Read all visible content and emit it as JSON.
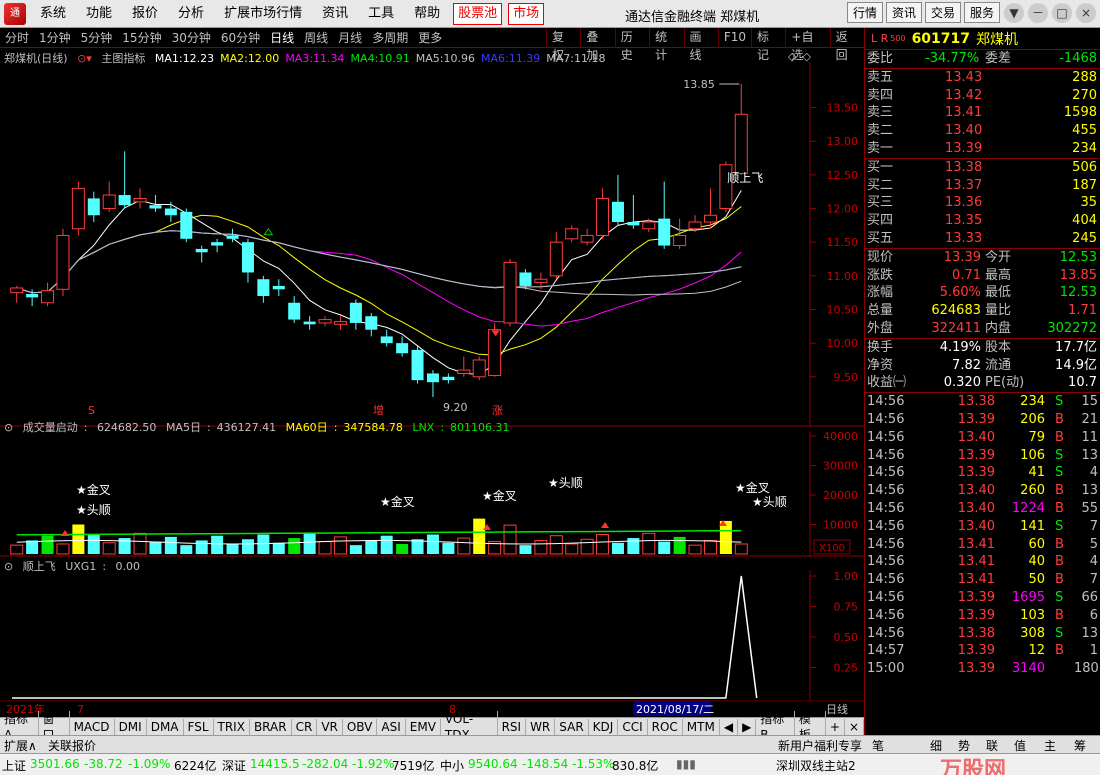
{
  "app": {
    "logo": "通",
    "menu": [
      "系统",
      "功能",
      "报价",
      "分析",
      "扩展市场行情",
      "资讯",
      "工具",
      "帮助"
    ],
    "menu_highlight": [
      "股票池",
      "市场"
    ],
    "title": "通达信金融终端  郑煤机",
    "right_buttons": [
      "行情",
      "资讯",
      "交易",
      "服务"
    ],
    "window_buttons": [
      "▼",
      "－",
      "□",
      "×"
    ]
  },
  "periods": {
    "items": [
      "分时",
      "1分钟",
      "5分钟",
      "15分钟",
      "30分钟",
      "60分钟",
      "日线",
      "周线",
      "月线",
      "多周期",
      "更多"
    ],
    "active": "日线",
    "tools": [
      "复权",
      "叠加",
      "历史",
      "统计",
      "画线",
      "F10",
      "标记",
      "+自选",
      "返回"
    ]
  },
  "main_chart": {
    "stock_label": "郑煤机(日线)",
    "indicator_label": "主图指标",
    "ma": [
      {
        "name": "MA1",
        "value": "12.23",
        "color": "#ffffff"
      },
      {
        "name": "MA2",
        "value": "12.00",
        "color": "#ffff00"
      },
      {
        "name": "MA3",
        "value": "11.34",
        "color": "#ff00ff"
      },
      {
        "name": "MA4",
        "value": "10.91",
        "color": "#00e600"
      },
      {
        "name": "MA5",
        "value": "10.96",
        "color": "#c0c0c0"
      },
      {
        "name": "MA6",
        "value": "11.39",
        "color": "#3c3cff"
      },
      {
        "name": "MA7",
        "value": "11.18",
        "color": "#c0c0c0"
      }
    ],
    "annotations": {
      "high": "13.85",
      "low": "9.20",
      "fly": "顺上飞",
      "s_mark": "S",
      "zeng": "增",
      "zhang": "涨"
    }
  },
  "volume_chart": {
    "title": "成交量启动",
    "value": "624682.50",
    "ma5_label": "MA5日",
    "ma5": "436127.41",
    "ma60_label": "MA60日",
    "ma60": "347584.78",
    "lnx_label": "LNX",
    "lnx": "801106.31",
    "unit": "X100",
    "labels": {
      "jincha": "★金叉",
      "toushun": "★头顺"
    }
  },
  "ind_chart": {
    "title": "顺上飞",
    "value_label": "UXG1",
    "value": "0.00"
  },
  "chart_data": [
    {
      "type": "candlestick",
      "title": "郑煤机(日线)",
      "ylim": [
        9.2,
        13.85
      ],
      "yticks": [
        "13.50",
        "13.00",
        "12.50",
        "12.00",
        "11.50",
        "11.00",
        "10.50",
        "10.00",
        "9.50"
      ],
      "candles": [
        [
          10.75,
          10.82,
          10.6,
          10.85
        ],
        [
          10.73,
          10.68,
          10.55,
          10.8
        ],
        [
          10.6,
          10.78,
          10.55,
          10.9
        ],
        [
          10.8,
          11.6,
          10.7,
          11.7
        ],
        [
          11.7,
          12.3,
          11.6,
          12.4
        ],
        [
          12.15,
          11.9,
          11.8,
          12.25
        ],
        [
          12.0,
          12.2,
          11.95,
          12.4
        ],
        [
          12.2,
          12.05,
          12.0,
          12.85
        ],
        [
          12.1,
          12.15,
          12.0,
          12.3
        ],
        [
          12.05,
          12.0,
          11.95,
          12.2
        ],
        [
          12.0,
          11.9,
          11.8,
          12.1
        ],
        [
          11.95,
          11.55,
          11.5,
          12.0
        ],
        [
          11.4,
          11.35,
          11.2,
          11.45
        ],
        [
          11.5,
          11.45,
          11.35,
          11.55
        ],
        [
          11.6,
          11.55,
          11.5,
          11.7
        ],
        [
          11.5,
          11.05,
          10.9,
          11.55
        ],
        [
          10.95,
          10.7,
          10.6,
          11.0
        ],
        [
          10.85,
          10.8,
          10.7,
          10.95
        ],
        [
          10.6,
          10.35,
          10.3,
          10.7
        ],
        [
          10.32,
          10.28,
          10.2,
          10.4
        ],
        [
          10.3,
          10.35,
          10.25,
          10.4
        ],
        [
          10.28,
          10.32,
          10.2,
          10.4
        ],
        [
          10.6,
          10.3,
          10.2,
          10.65
        ],
        [
          10.4,
          10.2,
          10.1,
          10.45
        ],
        [
          10.1,
          10.0,
          9.95,
          10.2
        ],
        [
          10.0,
          9.85,
          9.8,
          10.1
        ],
        [
          9.9,
          9.45,
          9.4,
          9.95
        ],
        [
          9.55,
          9.42,
          9.2,
          9.6
        ],
        [
          9.5,
          9.45,
          9.4,
          9.55
        ],
        [
          9.55,
          9.6,
          9.5,
          9.8
        ],
        [
          9.5,
          9.75,
          9.45,
          9.8
        ],
        [
          9.52,
          10.2,
          9.5,
          10.3
        ],
        [
          10.3,
          11.2,
          10.25,
          11.25
        ],
        [
          11.05,
          10.85,
          10.8,
          11.1
        ],
        [
          10.9,
          10.95,
          10.8,
          11.05
        ],
        [
          11.0,
          11.5,
          10.95,
          11.65
        ],
        [
          11.55,
          11.7,
          11.5,
          11.75
        ],
        [
          11.5,
          11.6,
          11.45,
          11.7
        ],
        [
          11.6,
          12.15,
          11.55,
          12.3
        ],
        [
          12.1,
          11.8,
          11.75,
          12.5
        ],
        [
          11.8,
          11.75,
          11.7,
          12.2
        ],
        [
          11.7,
          11.8,
          11.65,
          11.85
        ],
        [
          11.85,
          11.45,
          11.4,
          12.4
        ],
        [
          11.45,
          11.6,
          11.4,
          11.85
        ],
        [
          11.7,
          11.8,
          11.65,
          11.9
        ],
        [
          11.8,
          11.9,
          11.7,
          12.3
        ],
        [
          12.0,
          12.65,
          11.95,
          12.7
        ],
        [
          12.52,
          13.4,
          12.5,
          13.85
        ]
      ],
      "ma_series": [
        {
          "name": "MA1",
          "color": "#ffffff"
        },
        {
          "name": "MA2",
          "color": "#ffff00"
        },
        {
          "name": "MA3",
          "color": "#ff00ff"
        },
        {
          "name": "MA4",
          "color": "#00e600"
        },
        {
          "name": "MA5",
          "color": "#c0c0c0"
        },
        {
          "name": "MA6",
          "color": "#3c3cff"
        },
        {
          "name": "MA7",
          "color": "#c0c0c0"
        }
      ]
    },
    {
      "type": "bar",
      "title": "成交量启动",
      "ylim": [
        0,
        40000
      ],
      "yticks": [
        "40000",
        "30000",
        "20000",
        "10000"
      ]
    },
    {
      "type": "line",
      "title": "顺上飞",
      "ylim": [
        0,
        1
      ],
      "yticks": [
        "1.00",
        "0.75",
        "0.50",
        "0.25"
      ]
    }
  ],
  "xaxis": {
    "year": "2021年",
    "m7": "7",
    "m8": "8",
    "date_box": "2021/08/17/二",
    "period": "日线"
  },
  "quote": {
    "lr": "L R",
    "sub": "500",
    "code": "601717",
    "name": "郑煤机",
    "weibi_label": "委比",
    "weibi": "-34.77%",
    "weicha_label": "委差",
    "weicha": "-1468",
    "asks": [
      {
        "label": "卖五",
        "price": "13.43",
        "vol": "288"
      },
      {
        "label": "卖四",
        "price": "13.42",
        "vol": "270"
      },
      {
        "label": "卖三",
        "price": "13.41",
        "vol": "1598"
      },
      {
        "label": "卖二",
        "price": "13.40",
        "vol": "455"
      },
      {
        "label": "卖一",
        "price": "13.39",
        "vol": "234"
      }
    ],
    "bids": [
      {
        "label": "买一",
        "price": "13.38",
        "vol": "506"
      },
      {
        "label": "买二",
        "price": "13.37",
        "vol": "187"
      },
      {
        "label": "买三",
        "price": "13.36",
        "vol": "35"
      },
      {
        "label": "买四",
        "price": "13.35",
        "vol": "404"
      },
      {
        "label": "买五",
        "price": "13.33",
        "vol": "245"
      }
    ],
    "stats": [
      {
        "l1": "现价",
        "v1": "13.39",
        "c1": "red",
        "l2": "今开",
        "v2": "12.53",
        "c2": "grn"
      },
      {
        "l1": "涨跌",
        "v1": "0.71",
        "c1": "red",
        "l2": "最高",
        "v2": "13.85",
        "c2": "red"
      },
      {
        "l1": "涨幅",
        "v1": "5.60%",
        "c1": "red",
        "l2": "最低",
        "v2": "12.53",
        "c2": "grn"
      },
      {
        "l1": "总量",
        "v1": "624683",
        "c1": "yel",
        "l2": "量比",
        "v2": "1.71",
        "c2": "red"
      },
      {
        "l1": "外盘",
        "v1": "322411",
        "c1": "red",
        "l2": "内盘",
        "v2": "302272",
        "c2": "grn"
      }
    ],
    "stats2": [
      {
        "l1": "换手",
        "v1": "4.19%",
        "l2": "股本",
        "v2": "17.7亿"
      },
      {
        "l1": "净资",
        "v1": "7.82",
        "l2": "流通",
        "v2": "14.9亿"
      },
      {
        "l1": "收益㈠",
        "v1": "0.320",
        "l2": "PE(动)",
        "v2": "10.7"
      }
    ],
    "ticks": [
      {
        "t": "14:56",
        "p": "13.38",
        "pc": "red",
        "v": "234",
        "d": "S",
        "n": "15"
      },
      {
        "t": "14:56",
        "p": "13.39",
        "pc": "red",
        "v": "206",
        "d": "B",
        "n": "21"
      },
      {
        "t": "14:56",
        "p": "13.40",
        "pc": "red",
        "v": "79",
        "d": "B",
        "n": "11"
      },
      {
        "t": "14:56",
        "p": "13.39",
        "pc": "red",
        "v": "106",
        "d": "S",
        "n": "13"
      },
      {
        "t": "14:56",
        "p": "13.39",
        "pc": "red",
        "v": "41",
        "d": "S",
        "n": "4"
      },
      {
        "t": "14:56",
        "p": "13.40",
        "pc": "red",
        "v": "260",
        "d": "B",
        "n": "13"
      },
      {
        "t": "14:56",
        "p": "13.40",
        "pc": "red",
        "v": "1224",
        "d": "B",
        "n": "55"
      },
      {
        "t": "14:56",
        "p": "13.40",
        "pc": "red",
        "v": "141",
        "d": "S",
        "n": "7"
      },
      {
        "t": "14:56",
        "p": "13.41",
        "pc": "red",
        "v": "60",
        "d": "B",
        "n": "5"
      },
      {
        "t": "14:56",
        "p": "13.41",
        "pc": "red",
        "v": "40",
        "d": "B",
        "n": "4"
      },
      {
        "t": "14:56",
        "p": "13.41",
        "pc": "red",
        "v": "50",
        "d": "B",
        "n": "7"
      },
      {
        "t": "14:56",
        "p": "13.39",
        "pc": "red",
        "v": "1695",
        "d": "S",
        "n": "66"
      },
      {
        "t": "14:56",
        "p": "13.39",
        "pc": "red",
        "v": "103",
        "d": "B",
        "n": "6"
      },
      {
        "t": "14:56",
        "p": "13.38",
        "pc": "red",
        "v": "308",
        "d": "S",
        "n": "13"
      },
      {
        "t": "14:57",
        "p": "13.39",
        "pc": "red",
        "v": "12",
        "d": "B",
        "n": "1"
      },
      {
        "t": "15:00",
        "p": "13.39",
        "pc": "red",
        "v": "3140",
        "d": "",
        "n": "180"
      }
    ]
  },
  "bottom_tabs": [
    "指标A",
    "窗口",
    "MACD",
    "DMI",
    "DMA",
    "FSL",
    "TRIX",
    "BRAR",
    "CR",
    "VR",
    "OBV",
    "ASI",
    "EMV",
    "VOL-TDX",
    "RSI",
    "WR",
    "SAR",
    "KDJ",
    "CCI",
    "ROC",
    "MTM",
    "◀",
    "▶",
    "指标B",
    "模板",
    "+",
    "×"
  ],
  "bottom_tabs2": {
    "left": [
      "扩展∧",
      "关联报价"
    ],
    "right": [
      "新用户福利专享",
      "笔",
      "细",
      "势",
      "联",
      "值",
      "主",
      "筹"
    ]
  },
  "status": {
    "sh_label": "上证",
    "sh": "3501.66",
    "sh_chg": "-38.72",
    "sh_pct": "-1.09%",
    "sh_amt": "6224亿",
    "sz_label": "深证",
    "sz": "14415.5",
    "sz_chg": "-282.04",
    "sz_pct": "-1.92%",
    "sz_amt": "7519亿",
    "zx_label": "中小",
    "zx": "9540.64",
    "zx_chg": "-148.54",
    "zx_pct": "-1.53%",
    "zx_amt": "830.8亿",
    "server": "深圳双线主站2",
    "watermark": "万股网"
  }
}
